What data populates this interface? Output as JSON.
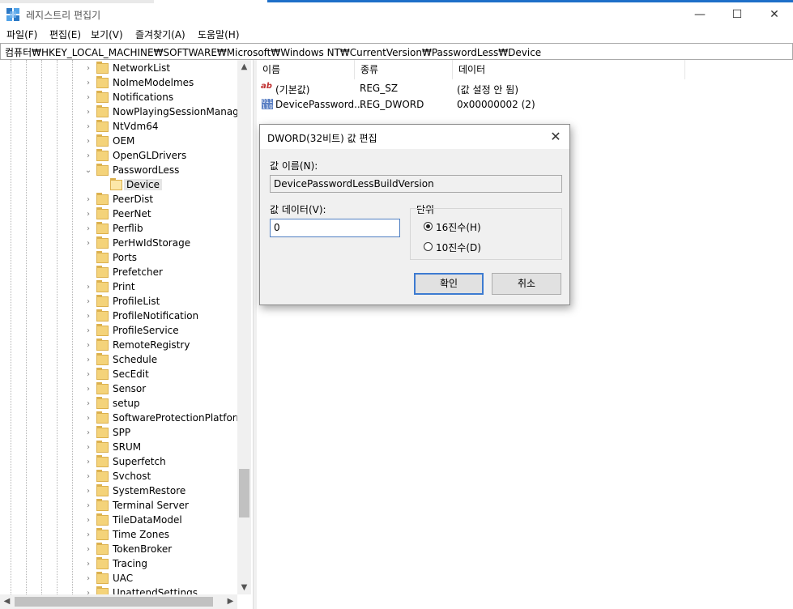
{
  "window": {
    "title": "레지스트리 편집기",
    "min_glyph": "—",
    "max_glyph": "☐",
    "close_glyph": "✕"
  },
  "menu": [
    "파일(F)",
    "편집(E)",
    "보기(V)",
    "즐겨찾기(A)",
    "도움말(H)"
  ],
  "address": "컴퓨터₩HKEY_LOCAL_MACHINE₩SOFTWARE₩Microsoft₩Windows NT₩CurrentVersion₩PasswordLess₩Device",
  "tree": [
    {
      "label": "NetworkList",
      "expander": "collapsed"
    },
    {
      "label": "NoImeModelmes",
      "expander": "collapsed"
    },
    {
      "label": "Notifications",
      "expander": "collapsed"
    },
    {
      "label": "NowPlayingSessionManager",
      "expander": "collapsed"
    },
    {
      "label": "NtVdm64",
      "expander": "collapsed"
    },
    {
      "label": "OEM",
      "expander": "collapsed"
    },
    {
      "label": "OpenGLDrivers",
      "expander": "collapsed"
    },
    {
      "label": "PasswordLess",
      "expander": "expanded"
    },
    {
      "label": "Device",
      "expander": "none",
      "selected": true,
      "child": true
    },
    {
      "label": "PeerDist",
      "expander": "collapsed"
    },
    {
      "label": "PeerNet",
      "expander": "collapsed"
    },
    {
      "label": "Perflib",
      "expander": "collapsed"
    },
    {
      "label": "PerHwIdStorage",
      "expander": "collapsed"
    },
    {
      "label": "Ports",
      "expander": "none"
    },
    {
      "label": "Prefetcher",
      "expander": "none"
    },
    {
      "label": "Print",
      "expander": "collapsed"
    },
    {
      "label": "ProfileList",
      "expander": "collapsed"
    },
    {
      "label": "ProfileNotification",
      "expander": "collapsed"
    },
    {
      "label": "ProfileService",
      "expander": "collapsed"
    },
    {
      "label": "RemoteRegistry",
      "expander": "collapsed"
    },
    {
      "label": "Schedule",
      "expander": "collapsed"
    },
    {
      "label": "SecEdit",
      "expander": "collapsed"
    },
    {
      "label": "Sensor",
      "expander": "collapsed"
    },
    {
      "label": "setup",
      "expander": "collapsed"
    },
    {
      "label": "SoftwareProtectionPlatform",
      "expander": "collapsed"
    },
    {
      "label": "SPP",
      "expander": "collapsed"
    },
    {
      "label": "SRUM",
      "expander": "collapsed"
    },
    {
      "label": "Superfetch",
      "expander": "collapsed"
    },
    {
      "label": "Svchost",
      "expander": "collapsed"
    },
    {
      "label": "SystemRestore",
      "expander": "collapsed"
    },
    {
      "label": "Terminal Server",
      "expander": "collapsed"
    },
    {
      "label": "TileDataModel",
      "expander": "collapsed"
    },
    {
      "label": "Time Zones",
      "expander": "collapsed"
    },
    {
      "label": "TokenBroker",
      "expander": "collapsed"
    },
    {
      "label": "Tracing",
      "expander": "collapsed"
    },
    {
      "label": "UAC",
      "expander": "collapsed"
    },
    {
      "label": "UnattendSettings",
      "expander": "collapsed"
    }
  ],
  "list": {
    "columns": [
      "이름",
      "종류",
      "데이터"
    ],
    "rows": [
      {
        "icon": "string-value-icon",
        "name": "(기본값)",
        "type": "REG_SZ",
        "data": "(값 설정 안 됨)"
      },
      {
        "icon": "binary-value-icon",
        "name": "DevicePassword...",
        "type": "REG_DWORD",
        "data": "0x00000002 (2)"
      }
    ]
  },
  "dialog": {
    "title": "DWORD(32비트) 값 편집",
    "value_name_label": "값 이름(N):",
    "value_name": "DevicePasswordLessBuildVersion",
    "value_data_label": "값 데이터(V):",
    "value_data": "0",
    "base_label": "단위",
    "base_options": [
      {
        "label": "16진수(H)",
        "selected": true
      },
      {
        "label": "10진수(D)",
        "selected": false
      }
    ],
    "ok_label": "확인",
    "cancel_label": "취소"
  },
  "colors": {
    "folder": "#f4d37a",
    "accent": "#1e6fc8",
    "selection": "#e5e5e5"
  }
}
